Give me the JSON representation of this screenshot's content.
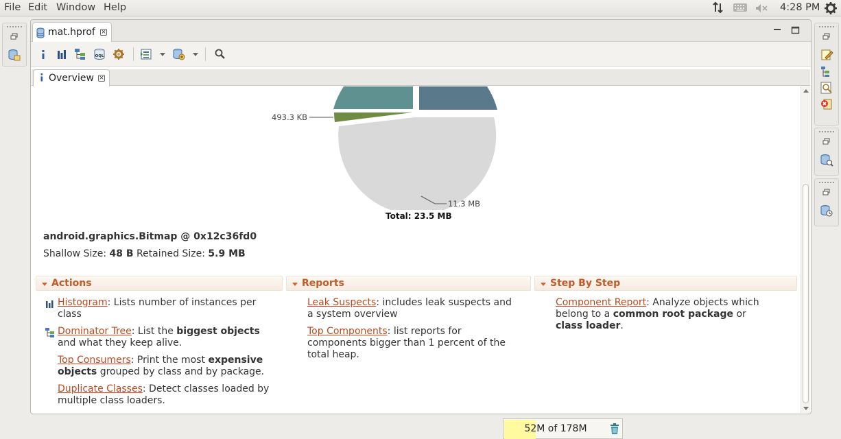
{
  "menubar": {
    "menus": [
      "File",
      "Edit",
      "Window",
      "Help"
    ],
    "clock": "4:28 PM",
    "tray_icons": [
      "network-arrows-icon",
      "keyboard-icon",
      "volume-muted-icon",
      "settings-gear-icon"
    ]
  },
  "editor": {
    "tab_label": "mat.hprof",
    "overview_tab_label": "Overview"
  },
  "toolbar": {
    "buttons": [
      "info-icon",
      "histogram-icon",
      "dominator-tree-icon",
      "oql-icon",
      "heap-dump-overview-icon",
      "reports-icon",
      "query-browser-icon",
      "search-icon"
    ]
  },
  "pie": {
    "label_small": "493.3 KB",
    "label_large": "11.3 MB",
    "total": "Total: 23.5 MB",
    "colors": {
      "teal": "#5f9191",
      "slate": "#5a7a8c",
      "olive": "#6f8c45",
      "gray": "#d9d9d9"
    }
  },
  "object": {
    "title": "android.graphics.Bitmap @ 0x12c36fd0",
    "shallow_label": "Shallow Size:",
    "shallow_value": "48 B",
    "retained_label": "Retained Size:",
    "retained_value": "5.9 MB"
  },
  "sections": {
    "actions": {
      "title": "Actions",
      "histogram": {
        "link": "Histogram",
        "text": ": Lists number of instances per class"
      },
      "dominator": {
        "link": "Dominator Tree",
        "text_a": ": List the ",
        "bold": "biggest objects",
        "text_b": " and what they keep alive."
      },
      "consumers": {
        "link": "Top Consumers",
        "text_a": ": Print the most ",
        "bold": "expensive objects",
        "text_b": " grouped by class and by package."
      },
      "duplicates": {
        "link": "Duplicate Classes",
        "text": ": Detect classes loaded by multiple class loaders."
      }
    },
    "reports": {
      "title": "Reports",
      "leak": {
        "link": "Leak Suspects",
        "text": ": includes leak suspects and a system overview"
      },
      "components": {
        "link": "Top Components",
        "text": ": list reports for components bigger than 1 percent of the total heap."
      }
    },
    "stepbystep": {
      "title": "Step By Step",
      "component": {
        "link": "Component Report",
        "text_a": ": Analyze objects which belong to a ",
        "bold_a": "common root package",
        "text_b": " or ",
        "bold_b": "class loader",
        "text_c": "."
      }
    }
  },
  "heap_status": {
    "text": "52M of 178M",
    "used_fraction": 0.29
  }
}
